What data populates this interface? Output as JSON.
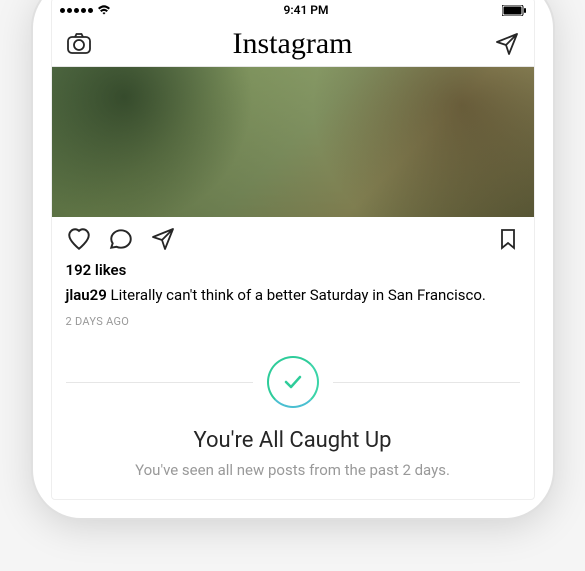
{
  "status": {
    "carrier_dots": 5,
    "time": "9:41 PM",
    "battery": "full"
  },
  "nav": {
    "logo": "Instagram"
  },
  "post": {
    "likes_text": "192 likes",
    "username": "jlau29",
    "caption": "Literally can't think of a better Saturday in San Francisco.",
    "timestamp": "2 DAYS AGO"
  },
  "caught_up": {
    "title": "You're All Caught Up",
    "subtitle": "You've seen all new posts from the past 2 days."
  }
}
